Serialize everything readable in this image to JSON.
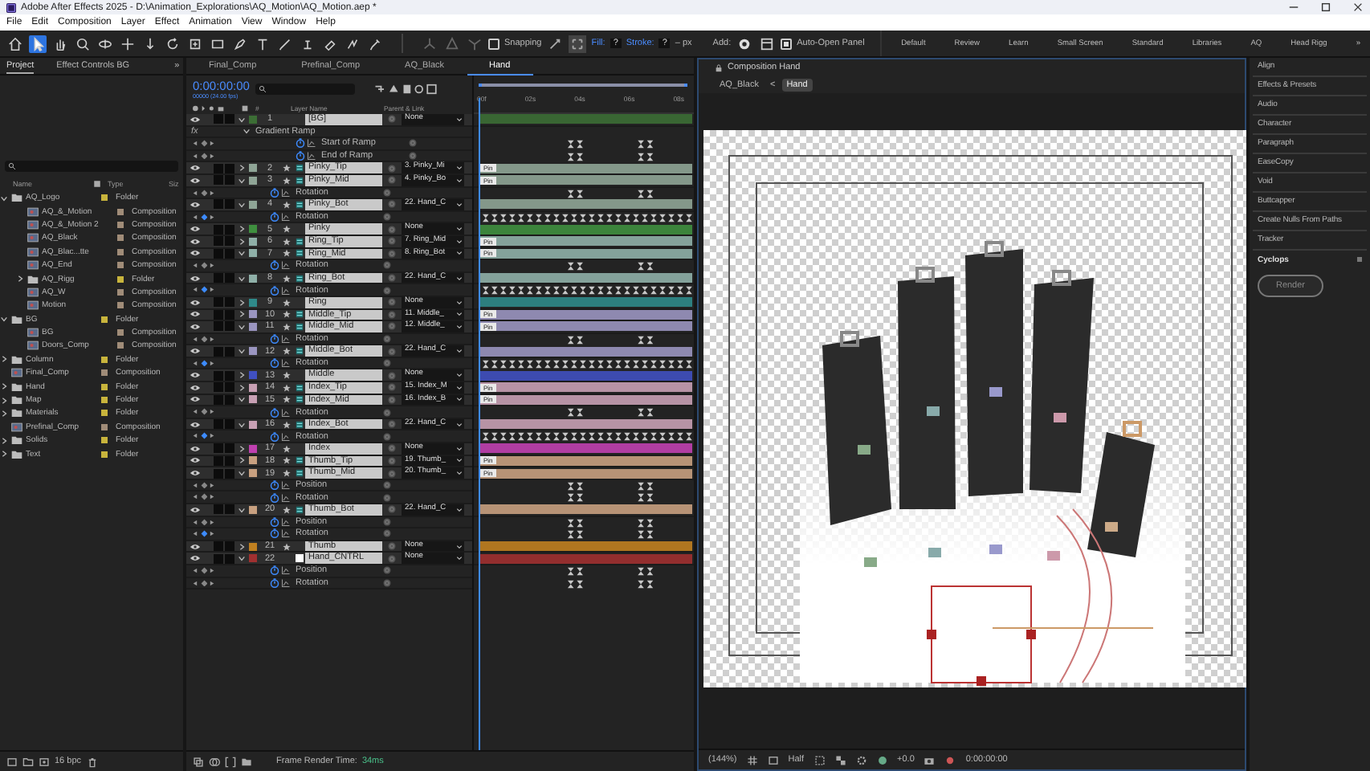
{
  "window": {
    "title": "Adobe After Effects 2025 - D:\\Animation_Explorations\\AQ_Motion\\AQ_Motion.aep *"
  },
  "menu": [
    "File",
    "Edit",
    "Composition",
    "Layer",
    "Effect",
    "Animation",
    "View",
    "Window",
    "Help"
  ],
  "toolbar": {
    "tools": [
      {
        "kind": "home",
        "selected": false
      },
      {
        "kind": "select",
        "selected": true
      },
      {
        "kind": "hand",
        "selected": false
      },
      {
        "kind": "zoom",
        "selected": false
      },
      {
        "kind": "orbit",
        "selected": false
      },
      {
        "kind": "pan",
        "selected": false
      },
      {
        "kind": "dolly",
        "selected": false
      },
      {
        "kind": "rotate",
        "selected": false
      },
      {
        "kind": "anchor",
        "selected": false
      },
      {
        "kind": "rectangle",
        "selected": false
      },
      {
        "kind": "pen",
        "selected": false
      },
      {
        "kind": "type",
        "selected": false
      },
      {
        "kind": "brush",
        "selected": false
      },
      {
        "kind": "stamp",
        "selected": false
      },
      {
        "kind": "eraser",
        "selected": false
      },
      {
        "kind": "roto",
        "selected": false
      },
      {
        "kind": "puppet",
        "selected": false
      }
    ],
    "snapping": {
      "label": "Snapping",
      "checked": false
    },
    "fill_label": "Fill:",
    "fill_value": "?",
    "stroke_label": "Stroke:",
    "stroke_value": "?",
    "stroke_unit": "– px",
    "add_label": "Add:",
    "auto_open": {
      "label": "Auto-Open Panel",
      "checked": true
    },
    "workspaces": [
      {
        "label": "Default",
        "selected": false
      },
      {
        "label": "Review",
        "selected": false
      },
      {
        "label": "Learn",
        "selected": false
      },
      {
        "label": "Small Screen",
        "selected": false
      },
      {
        "label": "Standard",
        "selected": false
      },
      {
        "label": "Libraries",
        "selected": false
      },
      {
        "label": "AQ",
        "selected": false
      },
      {
        "label": "Head Rigg",
        "selected": false
      }
    ],
    "more": "»"
  },
  "project": {
    "tabs": [
      {
        "label": "Project",
        "selected": true
      },
      {
        "label": "Effect Controls BG",
        "selected": false
      }
    ],
    "more": "»",
    "columns": [
      "Name",
      "Type",
      "Siz"
    ],
    "items": [
      {
        "name": "AQ_Logo",
        "kind": "folder",
        "type": "Folder",
        "expanded": true,
        "children": [
          {
            "name": "AQ_&_Motion",
            "kind": "comp",
            "type": "Composition"
          },
          {
            "name": "AQ_&_Motion 2",
            "kind": "comp",
            "type": "Composition"
          },
          {
            "name": "AQ_Black",
            "kind": "comp",
            "type": "Composition"
          },
          {
            "name": "AQ_Blac...tte",
            "kind": "comp",
            "type": "Composition"
          },
          {
            "name": "AQ_End",
            "kind": "comp",
            "type": "Composition"
          },
          {
            "name": "AQ_Rigg",
            "kind": "folder",
            "type": "Folder",
            "expanded": false
          },
          {
            "name": "AQ_W",
            "kind": "comp",
            "type": "Composition"
          },
          {
            "name": "Motion",
            "kind": "comp",
            "type": "Composition"
          }
        ]
      },
      {
        "name": "BG",
        "kind": "folder",
        "type": "Folder",
        "expanded": true,
        "children": [
          {
            "name": "BG",
            "kind": "comp",
            "type": "Composition"
          },
          {
            "name": "Doors_Comp",
            "kind": "comp",
            "type": "Composition"
          }
        ]
      },
      {
        "name": "Column",
        "kind": "folder",
        "type": "Folder",
        "expanded": false
      },
      {
        "name": "Final_Comp",
        "kind": "comp",
        "type": "Composition"
      },
      {
        "name": "Hand",
        "kind": "folder",
        "type": "Folder",
        "expanded": false
      },
      {
        "name": "Map",
        "kind": "folder",
        "type": "Folder",
        "expanded": false
      },
      {
        "name": "Materials",
        "kind": "folder",
        "type": "Folder",
        "expanded": false
      },
      {
        "name": "Prefinal_Comp",
        "kind": "comp",
        "type": "Composition"
      },
      {
        "name": "Solids",
        "kind": "folder",
        "type": "Folder",
        "expanded": false
      },
      {
        "name": "Text",
        "kind": "folder",
        "type": "Folder",
        "expanded": false
      }
    ],
    "bpc": "16 bpc"
  },
  "timeline": {
    "tabs": [
      {
        "label": "Final_Comp",
        "selected": false
      },
      {
        "label": "Prefinal_Comp",
        "selected": false
      },
      {
        "label": "AQ_Black",
        "selected": false
      },
      {
        "label": "Hand",
        "selected": true
      }
    ],
    "timecode": "0:00:00:00",
    "fps": "00000 (24.00 fps)",
    "columns": {
      "num": "#",
      "name": "Layer Name",
      "parent": "Parent & Link"
    },
    "ruler": [
      "00f",
      "02s",
      "04s",
      "06s",
      "08s"
    ],
    "rows": [
      {
        "kind": "layer",
        "num": "1",
        "name": "[BG]",
        "star": false,
        "pin": false,
        "solid_icon": false,
        "color": "#3c6e35",
        "parent": "None",
        "visible": true,
        "solo": false,
        "locked": false,
        "selected": true,
        "expanded": true,
        "children": [
          {
            "kind": "effect",
            "fx": "fx",
            "name": "Gradient Ramp",
            "expanded": true,
            "children": [
              {
                "kind": "prop",
                "name": "Start of Ramp",
                "at_key": false,
                "dense": false
              },
              {
                "kind": "prop",
                "name": "End of Ramp",
                "at_key": false,
                "dense": false
              }
            ]
          }
        ]
      },
      {
        "kind": "layer",
        "num": "2",
        "name": "Pinky_Tip",
        "star": true,
        "pin": true,
        "solid_icon": false,
        "color": "#8fa596",
        "parent": "3. Pinky_Mi",
        "visible": true,
        "solo": false,
        "locked": false,
        "selected": true,
        "expanded": false,
        "bar_label": "Pin"
      },
      {
        "kind": "layer",
        "num": "3",
        "name": "Pinky_Mid",
        "star": true,
        "pin": true,
        "solid_icon": false,
        "color": "#8fa596",
        "parent": "4. Pinky_Bo",
        "visible": true,
        "solo": false,
        "locked": false,
        "selected": true,
        "expanded": true,
        "bar_label": "Pin",
        "children": [
          {
            "kind": "prop",
            "name": "Rotation",
            "at_key": false,
            "dense": false
          }
        ]
      },
      {
        "kind": "layer",
        "num": "4",
        "name": "Pinky_Bot",
        "star": true,
        "pin": true,
        "solid_icon": false,
        "color": "#8fa596",
        "parent": "22. Hand_C",
        "visible": true,
        "solo": false,
        "locked": false,
        "selected": true,
        "expanded": true,
        "children": [
          {
            "kind": "prop",
            "name": "Rotation",
            "at_key": true,
            "dense": true
          }
        ]
      },
      {
        "kind": "layer",
        "num": "5",
        "name": "Pinky",
        "star": true,
        "pin": false,
        "solid_icon": false,
        "color": "#3f8f3f",
        "parent": "None",
        "visible": true,
        "solo": false,
        "locked": false,
        "selected": true,
        "expanded": false
      },
      {
        "kind": "layer",
        "num": "6",
        "name": "Ring_Tip",
        "star": true,
        "pin": true,
        "solid_icon": false,
        "color": "#8fb0a8",
        "parent": "7. Ring_Mid",
        "visible": true,
        "solo": false,
        "locked": false,
        "selected": true,
        "expanded": false,
        "bar_label": "Pin"
      },
      {
        "kind": "layer",
        "num": "7",
        "name": "Ring_Mid",
        "star": true,
        "pin": true,
        "solid_icon": false,
        "color": "#8fb0a8",
        "parent": "8. Ring_Bot",
        "visible": true,
        "solo": false,
        "locked": false,
        "selected": true,
        "expanded": true,
        "bar_label": "Pin",
        "children": [
          {
            "kind": "prop",
            "name": "Rotation",
            "at_key": false,
            "dense": false
          }
        ]
      },
      {
        "kind": "layer",
        "num": "8",
        "name": "Ring_Bot",
        "star": true,
        "pin": true,
        "solid_icon": false,
        "color": "#8fb0a8",
        "parent": "22. Hand_C",
        "visible": true,
        "solo": false,
        "locked": false,
        "selected": true,
        "expanded": true,
        "children": [
          {
            "kind": "prop",
            "name": "Rotation",
            "at_key": true,
            "dense": true
          }
        ]
      },
      {
        "kind": "layer",
        "num": "9",
        "name": "Ring",
        "star": true,
        "pin": false,
        "solid_icon": false,
        "color": "#2f8a8a",
        "parent": "None",
        "visible": true,
        "solo": false,
        "locked": false,
        "selected": true,
        "expanded": false
      },
      {
        "kind": "layer",
        "num": "10",
        "name": "Middle_Tip",
        "star": true,
        "pin": true,
        "solid_icon": false,
        "color": "#9a95c0",
        "parent": "11. Middle_",
        "visible": true,
        "solo": false,
        "locked": false,
        "selected": true,
        "expanded": false,
        "bar_label": "Pin"
      },
      {
        "kind": "layer",
        "num": "11",
        "name": "Middle_Mid",
        "star": true,
        "pin": true,
        "solid_icon": false,
        "color": "#9a95c0",
        "parent": "12. Middle_",
        "visible": true,
        "solo": false,
        "locked": false,
        "selected": true,
        "expanded": true,
        "bar_label": "Pin",
        "children": [
          {
            "kind": "prop",
            "name": "Rotation",
            "at_key": false,
            "dense": false
          }
        ]
      },
      {
        "kind": "layer",
        "num": "12",
        "name": "Middle_Bot",
        "star": true,
        "pin": true,
        "solid_icon": false,
        "color": "#9a95c0",
        "parent": "22. Hand_C",
        "visible": true,
        "solo": false,
        "locked": false,
        "selected": true,
        "expanded": true,
        "children": [
          {
            "kind": "prop",
            "name": "Rotation",
            "at_key": true,
            "dense": true
          }
        ]
      },
      {
        "kind": "layer",
        "num": "13",
        "name": "Middle",
        "star": true,
        "pin": false,
        "solid_icon": false,
        "color": "#4050c0",
        "parent": "None",
        "visible": true,
        "solo": false,
        "locked": false,
        "selected": true,
        "expanded": false
      },
      {
        "kind": "layer",
        "num": "14",
        "name": "Index_Tip",
        "star": true,
        "pin": true,
        "solid_icon": false,
        "color": "#c8a0b4",
        "parent": "15. Index_M",
        "visible": true,
        "solo": false,
        "locked": false,
        "selected": true,
        "expanded": false,
        "bar_label": "Pin"
      },
      {
        "kind": "layer",
        "num": "15",
        "name": "Index_Mid",
        "star": true,
        "pin": true,
        "solid_icon": false,
        "color": "#c8a0b4",
        "parent": "16. Index_B",
        "visible": true,
        "solo": false,
        "locked": false,
        "selected": true,
        "expanded": true,
        "bar_label": "Pin",
        "children": [
          {
            "kind": "prop",
            "name": "Rotation",
            "at_key": false,
            "dense": false
          }
        ]
      },
      {
        "kind": "layer",
        "num": "16",
        "name": "Index_Bot",
        "star": true,
        "pin": true,
        "solid_icon": false,
        "color": "#c8a0b4",
        "parent": "22. Hand_C",
        "visible": true,
        "solo": false,
        "locked": false,
        "selected": true,
        "expanded": true,
        "children": [
          {
            "kind": "prop",
            "name": "Rotation",
            "at_key": true,
            "dense": true
          }
        ]
      },
      {
        "kind": "layer",
        "num": "17",
        "name": "Index",
        "star": true,
        "pin": false,
        "solid_icon": false,
        "color": "#c040b0",
        "parent": "None",
        "visible": true,
        "solo": false,
        "locked": false,
        "selected": true,
        "expanded": false
      },
      {
        "kind": "layer",
        "num": "18",
        "name": "Thumb_Tip",
        "star": true,
        "pin": true,
        "solid_icon": false,
        "color": "#c8a080",
        "parent": "19. Thumb_",
        "visible": true,
        "solo": false,
        "locked": false,
        "selected": true,
        "expanded": false,
        "bar_label": "Pin"
      },
      {
        "kind": "layer",
        "num": "19",
        "name": "Thumb_Mid",
        "star": true,
        "pin": true,
        "solid_icon": false,
        "color": "#c8a080",
        "parent": "20. Thumb_",
        "visible": true,
        "solo": false,
        "locked": false,
        "selected": true,
        "expanded": true,
        "bar_label": "Pin",
        "children": [
          {
            "kind": "prop",
            "name": "Position",
            "at_key": false,
            "dense": false
          },
          {
            "kind": "prop",
            "name": "Rotation",
            "at_key": false,
            "dense": false
          }
        ]
      },
      {
        "kind": "layer",
        "num": "20",
        "name": "Thumb_Bot",
        "star": true,
        "pin": true,
        "solid_icon": false,
        "color": "#c8a080",
        "parent": "22. Hand_C",
        "visible": true,
        "solo": false,
        "locked": false,
        "selected": true,
        "expanded": true,
        "children": [
          {
            "kind": "prop",
            "name": "Position",
            "at_key": false,
            "dense": false
          },
          {
            "kind": "prop",
            "name": "Rotation",
            "at_key": true,
            "dense": false
          }
        ]
      },
      {
        "kind": "layer",
        "num": "21",
        "name": "Thumb",
        "star": true,
        "pin": false,
        "solid_icon": false,
        "color": "#c08020",
        "parent": "None",
        "visible": true,
        "solo": false,
        "locked": false,
        "selected": true,
        "expanded": false
      },
      {
        "kind": "layer",
        "num": "22",
        "name": "Hand_CNTRL",
        "star": false,
        "pin": false,
        "solid_icon": true,
        "color": "#a03030",
        "parent": "None",
        "visible": true,
        "solo": false,
        "locked": false,
        "selected": true,
        "expanded": true,
        "children": [
          {
            "kind": "prop",
            "name": "Position",
            "at_key": false,
            "dense": false
          },
          {
            "kind": "prop",
            "name": "Rotation",
            "at_key": false,
            "dense": false
          }
        ]
      }
    ],
    "render_time_label": "Frame Render Time:",
    "render_time": "34ms"
  },
  "viewer": {
    "tab": "Composition Hand",
    "breadcrumbs": [
      {
        "label": "AQ_Black",
        "selected": false
      },
      {
        "label": "Hand",
        "selected": true
      }
    ],
    "separator": "<",
    "zoom": "(144%)",
    "resolution": "Half",
    "exposure": "+0.0",
    "timecode": "0:00:00:00"
  },
  "panels": {
    "items": [
      "Align",
      "Effects & Presets",
      "Audio",
      "Character",
      "Paragraph",
      "EaseCopy",
      "Void",
      "Buttcapper",
      "Create Nulls From Paths",
      "Tracker"
    ],
    "cyclops": "Cyclops",
    "render": "Render"
  }
}
